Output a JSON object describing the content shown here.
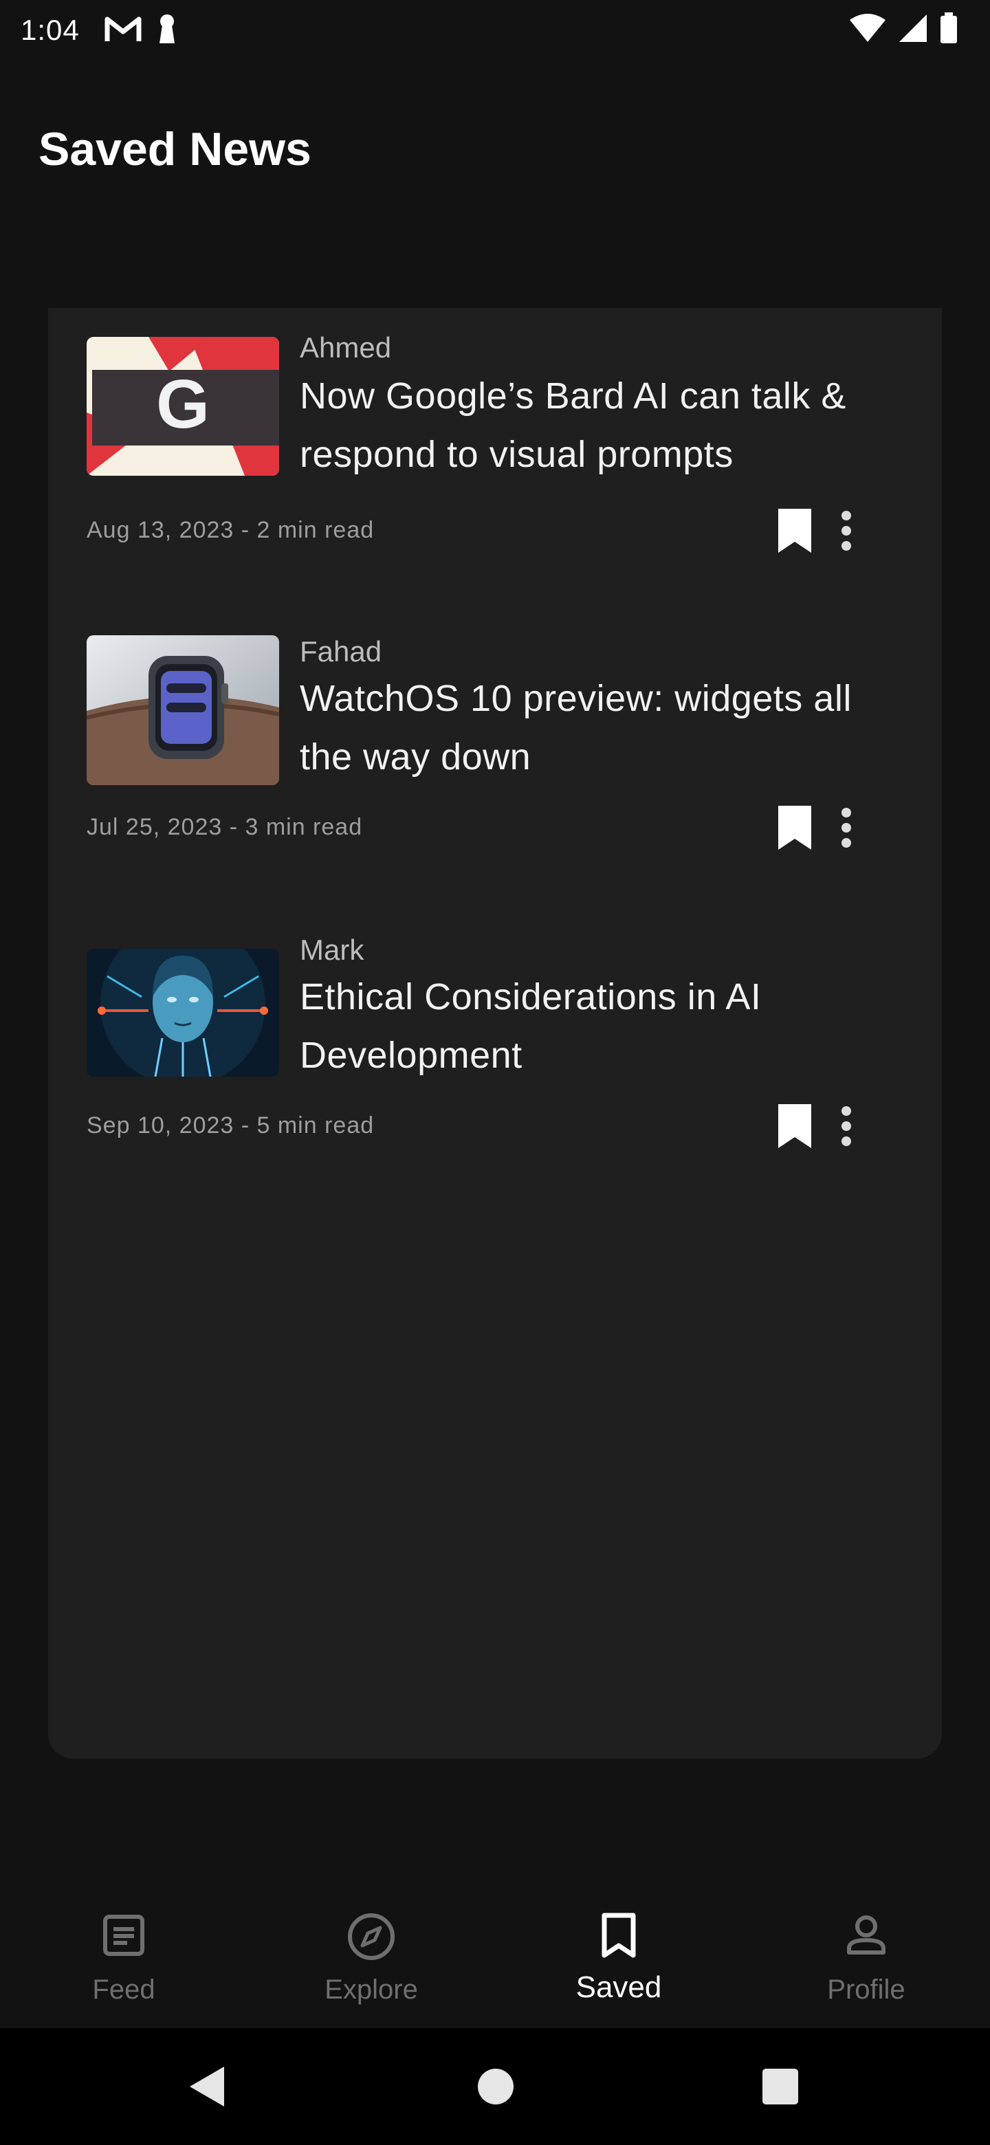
{
  "status_bar": {
    "time": "1:04",
    "icons": [
      "gmail-icon",
      "keyhole-icon",
      "wifi-icon",
      "signal-icon",
      "battery-icon"
    ]
  },
  "page": {
    "title": "Saved News"
  },
  "articles": [
    {
      "author": "Ahmed",
      "headline": "Now Google’s Bard AI can talk & respond to visual prompts",
      "meta": "Aug 13, 2023 - 2 min read",
      "thumbnail_logo_letter": "G"
    },
    {
      "author": "Fahad",
      "headline": "WatchOS 10 preview: widgets all the way down",
      "meta": "Jul 25, 2023 - 3 min read"
    },
    {
      "author": "Mark",
      "headline": "Ethical Considerations in AI Development",
      "meta": "Sep 10, 2023 - 5 min read"
    }
  ],
  "bottom_nav": {
    "items": [
      {
        "label": "Feed",
        "icon": "article-icon",
        "active": false
      },
      {
        "label": "Explore",
        "icon": "compass-icon",
        "active": false
      },
      {
        "label": "Saved",
        "icon": "bookmark-icon",
        "active": true
      },
      {
        "label": "Profile",
        "icon": "person-icon",
        "active": false
      }
    ]
  },
  "colors": {
    "background": "#121212",
    "card": "#1f1f1f",
    "text_primary": "#f2f2f2",
    "text_secondary": "#9e9e9e",
    "nav_inactive": "#6f6f6f"
  }
}
